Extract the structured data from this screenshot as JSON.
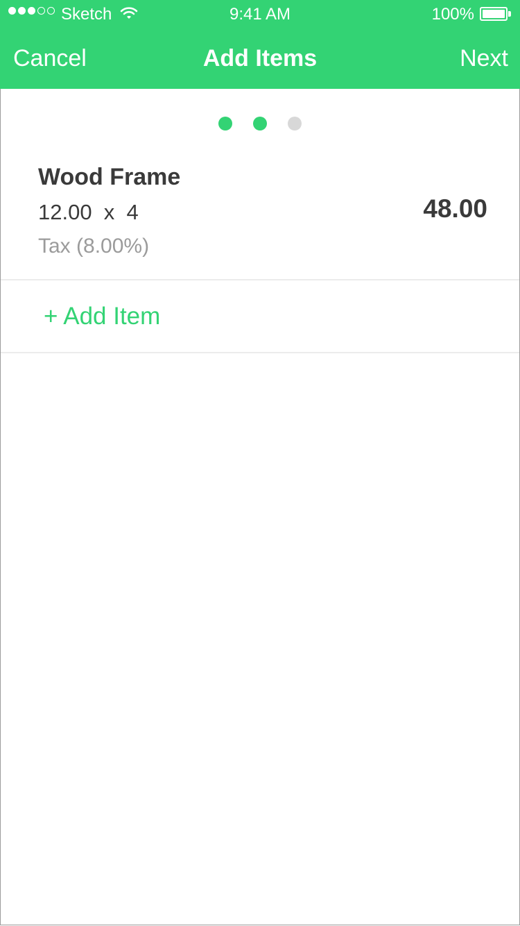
{
  "status_bar": {
    "carrier": "Sketch",
    "time": "9:41 AM",
    "battery": "100%",
    "signal_full": 3,
    "signal_total": 5
  },
  "nav": {
    "cancel_label": "Cancel",
    "title": "Add Items",
    "next_label": "Next"
  },
  "pager": {
    "total": 3,
    "completed": 2,
    "active_color": "#33d374",
    "inactive_color": "#d8d8d8"
  },
  "item": {
    "name": "Wood Frame",
    "quantity_line": "12.00  x  4",
    "tax": "Tax (8.00%)",
    "total": "48.00"
  },
  "actions": {
    "add_item_label": "+ Add Item"
  },
  "colors": {
    "accent": "#33d374"
  },
  "icons": {
    "signal": "signal-dots-icon",
    "wifi": "wifi-icon",
    "battery": "battery-icon"
  }
}
